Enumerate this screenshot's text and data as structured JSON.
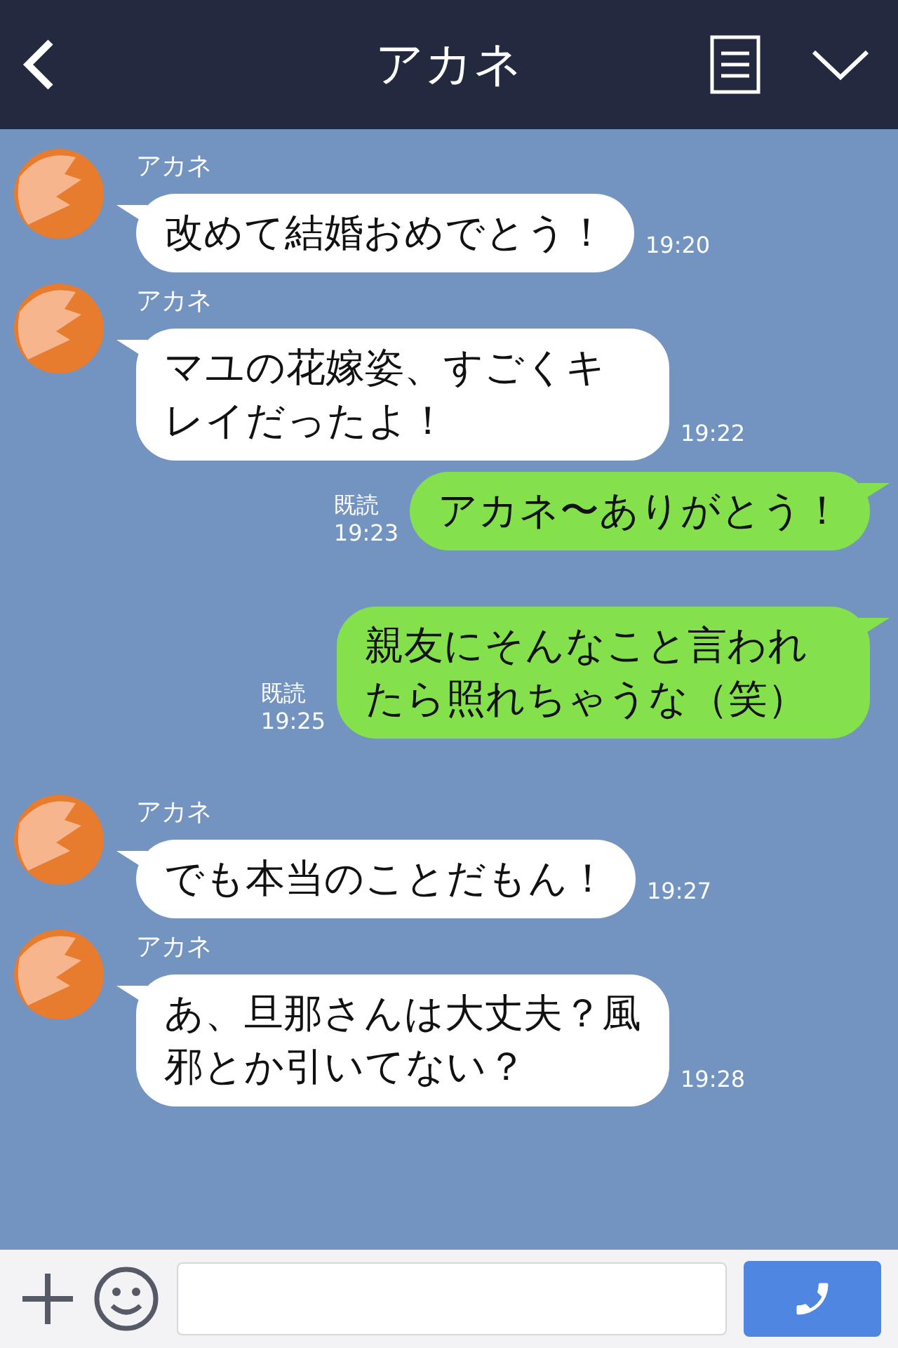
{
  "header": {
    "title": "アカネ"
  },
  "messages": [
    {
      "kind": "in",
      "name": "アカネ",
      "text": "改めて結婚おめでとう！",
      "time": "19:20"
    },
    {
      "kind": "in",
      "name": "アカネ",
      "text": "マユの花嫁姿、すごくキレイだったよ！",
      "time": "19:22"
    },
    {
      "kind": "out",
      "read": "既読",
      "text": "アカネ〜ありがとう！",
      "time": "19:23"
    },
    {
      "kind": "out",
      "read": "既読",
      "text": "親友にそんなこと言われたら照れちゃうな（笑）",
      "time": "19:25"
    },
    {
      "kind": "in",
      "name": "アカネ",
      "text": "でも本当のことだもん！",
      "time": "19:27"
    },
    {
      "kind": "in",
      "name": "アカネ",
      "text": "あ、旦那さんは大丈夫？風邪とか引いてない？",
      "time": "19:28"
    }
  ]
}
